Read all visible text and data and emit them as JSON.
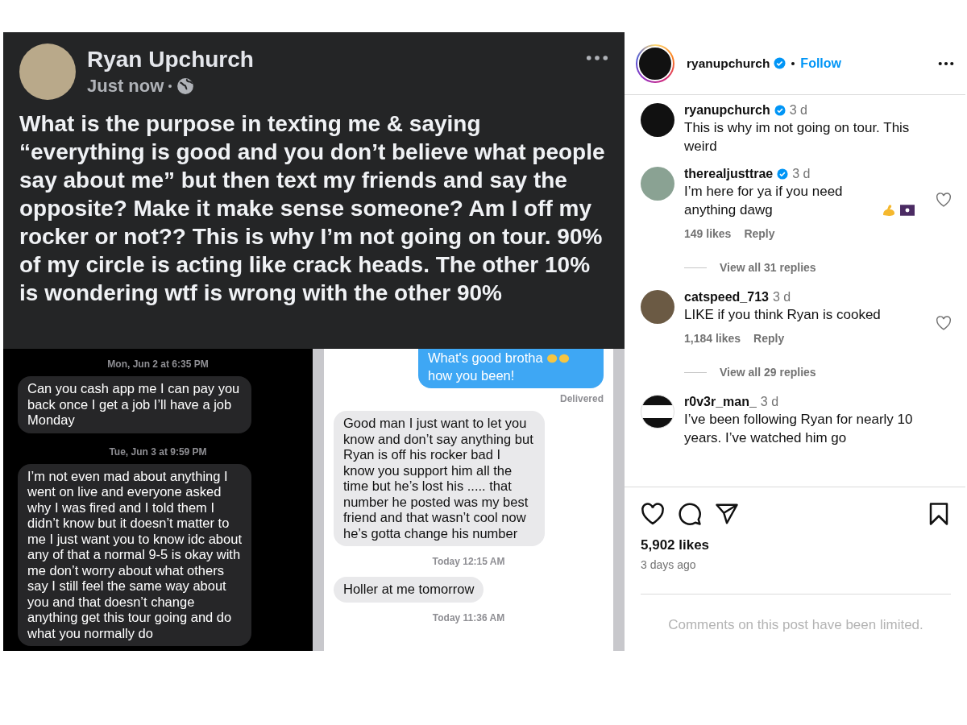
{
  "facebook_post": {
    "author": "Ryan Upchurch",
    "time": "Just now",
    "text": "What is the purpose in texting me & saying “everything is good and you don’t believe what people say about me” but then text my friends and say the opposite? Make it make sense someone? Am I off my rocker or not?? This is why I’m not going on tour. 90% of my circle is acting like crack heads. The other 10% is wondering wtf is wrong with the other 90%"
  },
  "left_chat": {
    "messages": [
      {
        "kind": "timestamp",
        "text": "Mon, Jun 2 at 6:35 PM"
      },
      {
        "kind": "received",
        "text": "Can you cash app me I can pay you back once I get a job I’ll have a job Monday"
      },
      {
        "kind": "timestamp",
        "text": "Tue, Jun 3 at 9:59 PM"
      },
      {
        "kind": "received",
        "text": "I’m not even mad about anything I went on live and everyone asked why I was fired and I told them I didn’t know but it doesn’t matter to me I just want you to know idc about any of that a normal 9-5 is okay with me don’t worry about what others say I still feel the same way about you and that doesn’t change anything get this tour going and do what you normally do"
      }
    ]
  },
  "right_chat": {
    "messages": [
      {
        "kind": "sent",
        "text": "What's good brotha"
      },
      {
        "kind": "sent",
        "text": "how you been!"
      },
      {
        "kind": "status",
        "text": "Delivered"
      },
      {
        "kind": "received",
        "text": "Good man I just want to let you know and don’t say anything but Ryan is off his rocker bad I know you support him all the time but he’s lost his ..... that number he posted was my best friend and that wasn’t cool now he’s gotta change his number"
      },
      {
        "kind": "timestamp",
        "text": "Today 12:15 AM"
      },
      {
        "kind": "received",
        "text": "Holler at me tomorrow"
      },
      {
        "kind": "timestamp",
        "text": "Today 11:36 AM"
      }
    ]
  },
  "instagram": {
    "header": {
      "username": "ryanupchurch",
      "verified": true,
      "follow": "Follow"
    },
    "comments": [
      {
        "kind": "caption",
        "username": "ryanupchurch",
        "verified": true,
        "time": "3 d",
        "text": "This is why im not going on tour. This weird"
      },
      {
        "kind": "comment",
        "username": "therealjusttrae",
        "verified": true,
        "time": "3 d",
        "text": "I’m here for ya if you need anything dawg",
        "liked": false,
        "likes": "149 likes",
        "reply": "Reply",
        "view_replies": "View all 31 replies"
      },
      {
        "kind": "comment",
        "username": "catspeed_713",
        "verified": false,
        "time": "3 d",
        "text": "LIKE if you think Ryan is cooked",
        "liked": false,
        "likes": "1,184 likes",
        "reply": "Reply",
        "view_replies": "View all 29 replies"
      },
      {
        "kind": "comment",
        "username": "r0v3r_man_",
        "verified": false,
        "time": "3 d",
        "text": "I’ve been following Ryan for nearly 10 years. I’ve watched him go"
      }
    ],
    "liked": false,
    "saved": false,
    "likes": "5,902 likes",
    "date": "3 days ago",
    "limited_notice": "Comments on this post have been limited."
  }
}
